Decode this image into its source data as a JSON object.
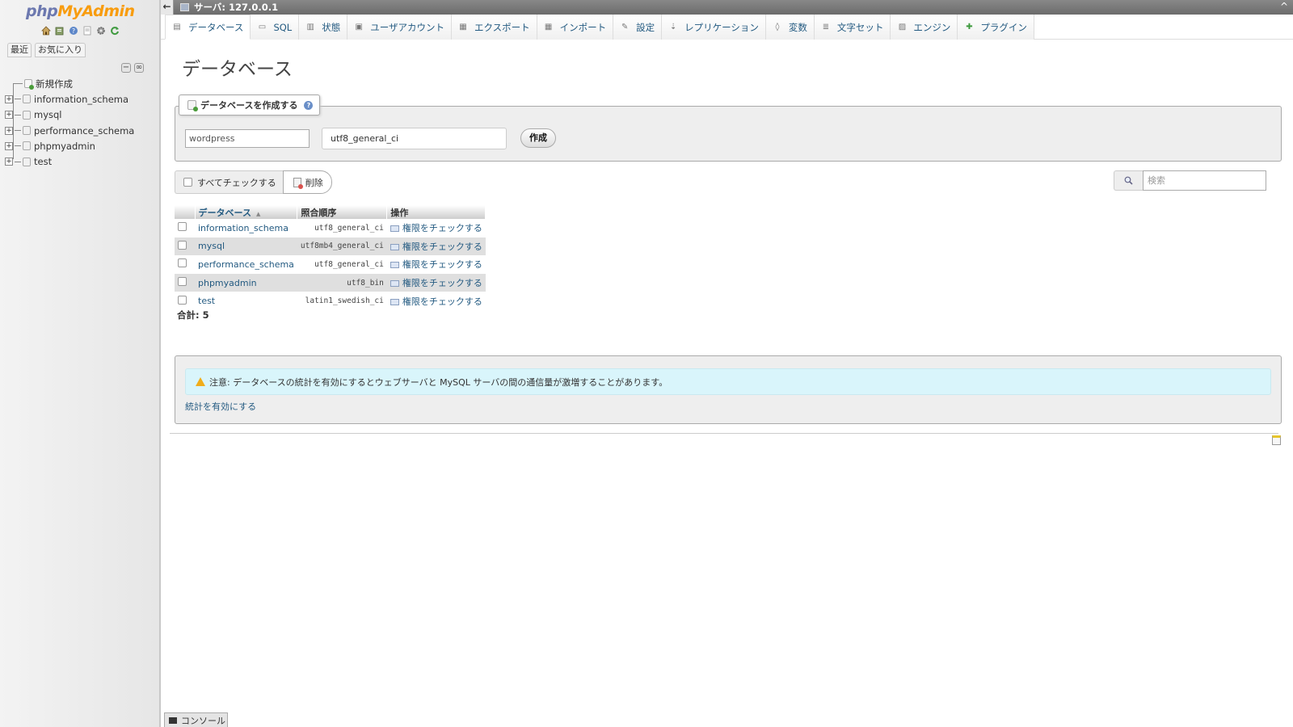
{
  "nav": {
    "logo_php": "php",
    "logo_myadmin": "MyAdmin",
    "icons": [
      "home-icon",
      "sql-query-icon",
      "help-icon",
      "docs-icon",
      "settings-icon",
      "reload-icon"
    ],
    "tabs": [
      "最近",
      "お気に入り"
    ],
    "tree": [
      {
        "label": "新規作成",
        "type": "new"
      },
      {
        "label": "information_schema",
        "type": "db"
      },
      {
        "label": "mysql",
        "type": "db"
      },
      {
        "label": "performance_schema",
        "type": "db"
      },
      {
        "label": "phpmyadmin",
        "type": "db"
      },
      {
        "label": "test",
        "type": "db"
      }
    ]
  },
  "topbar": {
    "breadcrumb": "サーバ: 127.0.0.1"
  },
  "menu": {
    "tabs": [
      {
        "label": "データベース",
        "icon": "database-icon",
        "active": true
      },
      {
        "label": "SQL",
        "icon": "sql-icon"
      },
      {
        "label": "状態",
        "icon": "status-icon"
      },
      {
        "label": "ユーザアカウント",
        "icon": "users-icon"
      },
      {
        "label": "エクスポート",
        "icon": "export-icon"
      },
      {
        "label": "インポート",
        "icon": "import-icon"
      },
      {
        "label": "設定",
        "icon": "settings-icon"
      },
      {
        "label": "レプリケーション",
        "icon": "replication-icon"
      },
      {
        "label": "変数",
        "icon": "variables-icon"
      },
      {
        "label": "文字セット",
        "icon": "charset-icon"
      },
      {
        "label": "エンジン",
        "icon": "engine-icon"
      },
      {
        "label": "プラグイン",
        "icon": "plugin-icon"
      }
    ]
  },
  "main": {
    "title": "データベース",
    "create": {
      "legend": "データベースを作成する",
      "dbname_value": "wordpress",
      "collation_value": "utf8_general_ci",
      "submit_label": "作成"
    },
    "toolbar": {
      "check_all_label": "すべてチェックする",
      "delete_label": "削除",
      "search_placeholder": "検索"
    },
    "table": {
      "headers": {
        "database": "データベース",
        "collation": "照合順序",
        "action": "操作"
      },
      "rows": [
        {
          "name": "information_schema",
          "collation": "utf8_general_ci",
          "action": "権限をチェックする"
        },
        {
          "name": "mysql",
          "collation": "utf8mb4_general_ci",
          "action": "権限をチェックする"
        },
        {
          "name": "performance_schema",
          "collation": "utf8_general_ci",
          "action": "権限をチェックする"
        },
        {
          "name": "phpmyadmin",
          "collation": "utf8_bin",
          "action": "権限をチェックする"
        },
        {
          "name": "test",
          "collation": "latin1_swedish_ci",
          "action": "権限をチェックする"
        }
      ]
    },
    "total": "合計: 5",
    "notice": {
      "text": "注意: データベースの統計を有効にするとウェブサーバと MySQL サーバの間の通信量が激増することがあります。",
      "enable_link": "統計を有効にする"
    }
  },
  "console": {
    "label": "コンソール"
  }
}
